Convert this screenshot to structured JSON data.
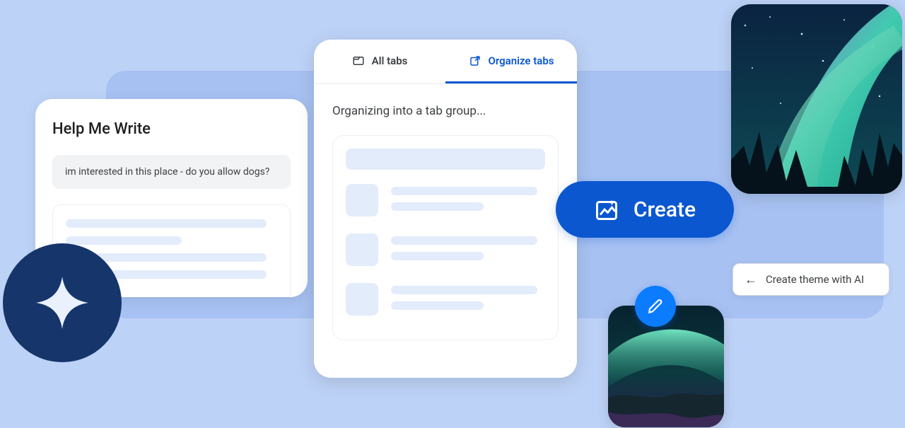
{
  "help_me_write": {
    "title": "Help Me Write",
    "prompt": "im interested in this place - do you allow dogs?"
  },
  "tab_organizer": {
    "tab_all": "All tabs",
    "tab_organize": "Organize tabs",
    "status": "Organizing into a tab group..."
  },
  "create_button": {
    "label": "Create"
  },
  "theme_chip": {
    "label": "Create theme with AI"
  },
  "colors": {
    "accent": "#0b57d0",
    "bg": "#bdd2f7",
    "bg_accent": "#a7c1f2",
    "star_badge": "#15356b",
    "edit_fab": "#0b7bff"
  }
}
